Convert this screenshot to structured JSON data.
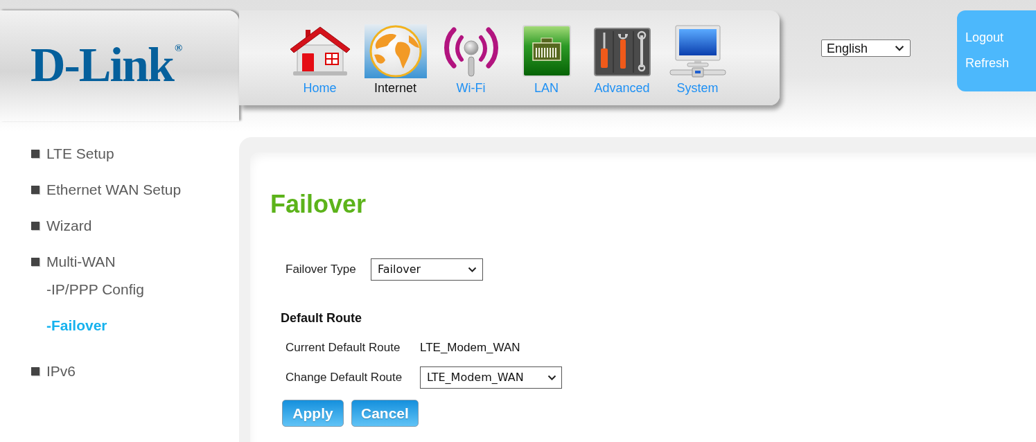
{
  "header": {
    "logo": {
      "name": "D-Link",
      "mark": "®"
    },
    "nav": [
      {
        "label": "Home",
        "selected": false
      },
      {
        "label": "Internet",
        "selected": true
      },
      {
        "label": "Wi-Fi",
        "selected": false
      },
      {
        "label": "LAN",
        "selected": false
      },
      {
        "label": "Advanced",
        "selected": false
      },
      {
        "label": "System",
        "selected": false
      }
    ],
    "language_select": {
      "value": "English"
    },
    "account_links": [
      "Logout",
      "Refresh"
    ]
  },
  "sidebar": {
    "items": [
      {
        "label": "LTE Setup",
        "selected": false
      },
      {
        "label": "Ethernet WAN Setup",
        "selected": false
      },
      {
        "label": "Wizard",
        "selected": false
      },
      {
        "label": "Multi-WAN",
        "selected": false,
        "children": [
          {
            "label": "-IP/PPP Config",
            "selected": false
          },
          {
            "label": "-Failover",
            "selected": true
          }
        ]
      },
      {
        "label": "IPv6",
        "selected": false
      }
    ]
  },
  "content": {
    "title": "Failover",
    "failover_type": {
      "label": "Failover Type",
      "value": "Failover"
    },
    "default_route": {
      "heading": "Default Route",
      "current": {
        "label": "Current Default Route",
        "value": "LTE_Modem_WAN"
      },
      "change": {
        "label": "Change Default Route",
        "value": "LTE_Modem_WAN"
      }
    },
    "buttons": [
      "Apply",
      "Cancel"
    ]
  }
}
